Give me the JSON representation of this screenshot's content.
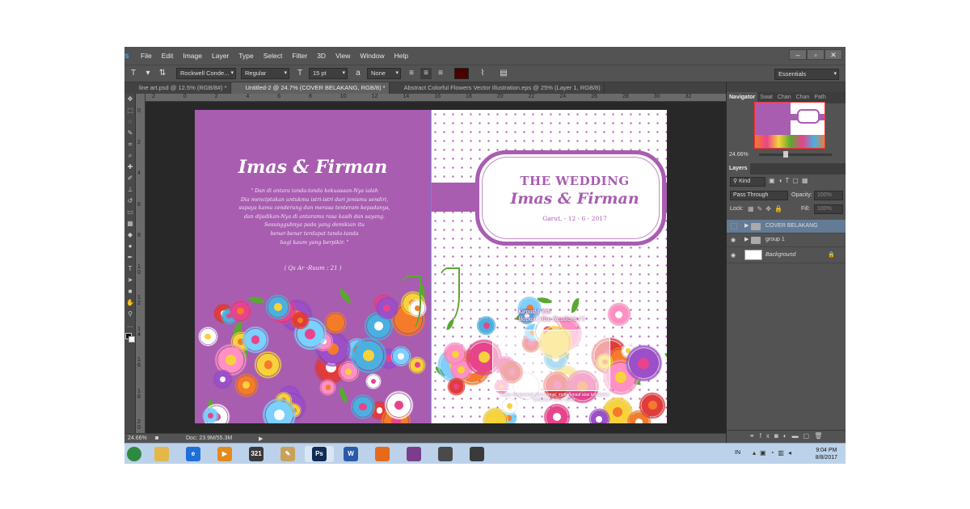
{
  "menu": {
    "app_logo": "s",
    "items": [
      "File",
      "Edit",
      "Image",
      "Layer",
      "Type",
      "Select",
      "Filter",
      "3D",
      "View",
      "Window",
      "Help"
    ],
    "window_controls": [
      "–",
      "▫",
      "✕"
    ]
  },
  "options_bar": {
    "type_tool_icon": "T",
    "font_family": "Rockwell Conde...",
    "font_style": "Regular",
    "font_size": "15 pt",
    "anti_alias_prefix": "a",
    "anti_alias": "None",
    "workspace": "Essentials"
  },
  "tabs": [
    {
      "label": "line art.psd @ 12.5% (RGB/8#) *",
      "active": false
    },
    {
      "label": "Untitled-2 @ 24.7% (COVER BELAKANG, RGB/8) *",
      "active": true
    },
    {
      "label": "Abstract Colorful Flowers Vector Illustration.eps @ 25% (Layer 1, RGB/8)",
      "active": false
    }
  ],
  "ruler": {
    "top_ticks": [
      "2",
      "0",
      "2",
      "4",
      "6",
      "8",
      "10",
      "12",
      "14",
      "16",
      "18",
      "20",
      "22",
      "24",
      "26",
      "28",
      "30",
      "32"
    ],
    "left_ticks": [
      "0",
      "2",
      "4",
      "6",
      "8",
      "1 0",
      "1 2",
      "1 4",
      "1 6",
      "1 8",
      "2 0"
    ]
  },
  "document": {
    "left_page": {
      "couple": "Imas & Firman",
      "verse_lines": [
        "\" Dan di antara tanda-tanda kekuasaan-Nya ialah",
        "Dia menciptakan untukmu istri-istri dari jenismu sendiri,",
        "supaya kamu cenderung dan merasa tenteram kepadanya,",
        "dan dijadikan-Nya di antaramu rasa kasih dan sayang.",
        "Sesungguhnya pada yang demikian itu",
        "benar-benar terdapat tanda-tanda",
        "bagi kaum yang berpikir. \""
      ],
      "verse_source": "( Qs Ar -Ruum : 21 )"
    },
    "right_page": {
      "title": "THE WEDDING",
      "couple": "Imas & Firman",
      "date": "Garut, - 12 - 6 - 2017",
      "recipient_lines": [
        "Kepada Yth",
        "Bapak / Ibu Saudara / i"
      ],
      "footer_note": "Tanpa mengurangi rasa hormat, mohon maaf atas kesalahan penulisan nama / gelar"
    },
    "colors": {
      "accent": "#a85db0",
      "dots": "#b05cb4",
      "leaf": "#5aa832"
    }
  },
  "status_bar": {
    "zoom": "24.66%",
    "doc_size": "Doc: 23.9M/55.3M"
  },
  "panels": {
    "navigator_tabs": [
      "Navigator",
      "Swat",
      "Chan",
      "Chan",
      "Path"
    ],
    "navigator_zoom": "24.66%",
    "layers_tab": "Layers",
    "filter_kind": "Kind",
    "blend_mode": "Pass Through",
    "opacity_label": "Opacity:",
    "opacity_value": "100%",
    "lock_label": "Lock:",
    "fill_label": "Fill:",
    "fill_value": "100%",
    "layers": [
      {
        "name": "COVER BELAKANG",
        "kind": "group",
        "selected": true,
        "visible": false
      },
      {
        "name": "group 1",
        "kind": "group",
        "selected": false,
        "visible": true
      },
      {
        "name": "Background",
        "kind": "background",
        "selected": false,
        "visible": true
      }
    ],
    "bottom_icons": [
      "link-icon",
      "fx-icon",
      "mask-icon",
      "adjustment-icon",
      "group-icon",
      "new-layer-icon",
      "trash-icon"
    ]
  },
  "taskbar": {
    "apps": [
      {
        "name": "start-orb-icon",
        "glyph": "",
        "color": "#2d8a3e"
      },
      {
        "name": "explorer-icon",
        "glyph": "",
        "color": "#e3b74a"
      },
      {
        "name": "ie-icon",
        "glyph": "e",
        "color": "#1f6fd6"
      },
      {
        "name": "media-player-icon",
        "glyph": "▶",
        "color": "#e38a1c"
      },
      {
        "name": "321-player-icon",
        "glyph": "321",
        "color": "#3a3a3a"
      },
      {
        "name": "pencil-app-icon",
        "glyph": "✎",
        "color": "#c8a25a"
      },
      {
        "name": "photoshop-icon",
        "glyph": "Ps",
        "color": "#0f2c55"
      },
      {
        "name": "word-icon",
        "glyph": "W",
        "color": "#2b5aa8"
      },
      {
        "name": "firefox-icon",
        "glyph": "",
        "color": "#e56a1b"
      },
      {
        "name": "winrar-icon",
        "glyph": "",
        "color": "#7d3d8c"
      },
      {
        "name": "media-app-icon",
        "glyph": "",
        "color": "#4a4a4a"
      },
      {
        "name": "media-app-2-icon",
        "glyph": "",
        "color": "#3a3a3a"
      }
    ],
    "language": "IN",
    "time": "9:04 PM",
    "date": "8/8/2017"
  }
}
